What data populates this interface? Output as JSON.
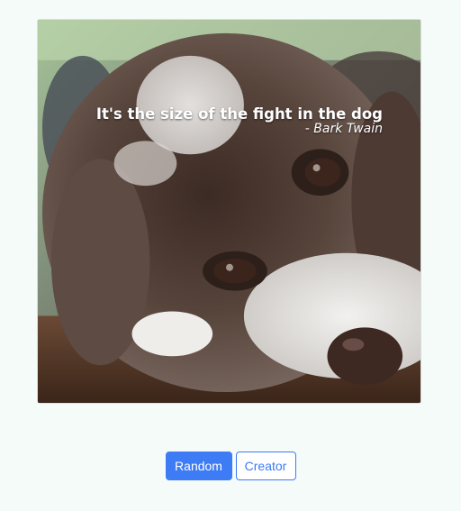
{
  "quote": {
    "text": "It's the size of the fight in the dog",
    "author": "- Bark Twain"
  },
  "buttons": {
    "random_label": "Random",
    "creator_label": "Creator"
  },
  "colors": {
    "page_background": "#f5fbf8",
    "accent": "#3d7cf5",
    "quote_text": "#ffffff"
  }
}
